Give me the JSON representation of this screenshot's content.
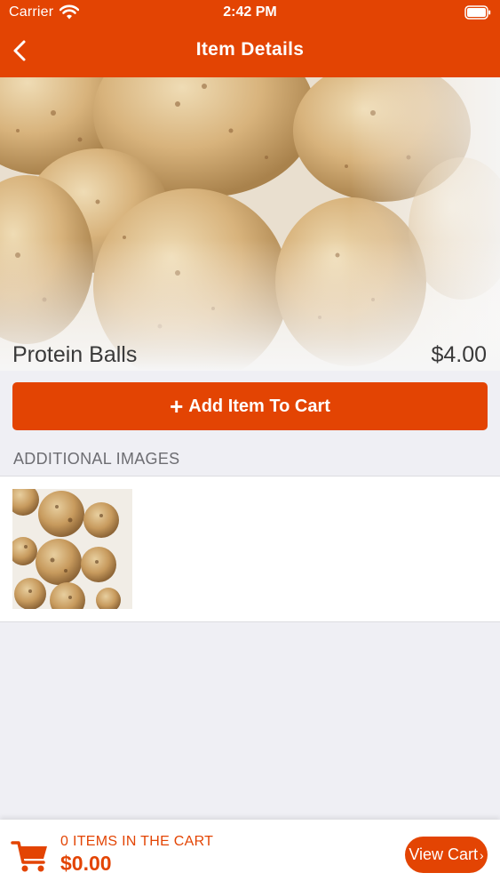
{
  "status_bar": {
    "carrier": "Carrier",
    "time": "2:42 PM"
  },
  "nav": {
    "title": "Item Details",
    "back_icon": "chevron-left-icon"
  },
  "item": {
    "name": "Protein Balls",
    "price": "$4.00"
  },
  "actions": {
    "add_to_cart": "Add Item To Cart",
    "add_icon": "plus-icon"
  },
  "additional_images": {
    "title": "ADDITIONAL IMAGES"
  },
  "cart": {
    "count_text": "0 ITEMS IN THE CART",
    "total": "$0.00",
    "view_cart": "View Cart",
    "view_cart_icon": "chevron-right-icon",
    "cart_icon": "shopping-cart-icon"
  },
  "colors": {
    "brand": "#e34403",
    "background": "#efeff4"
  }
}
